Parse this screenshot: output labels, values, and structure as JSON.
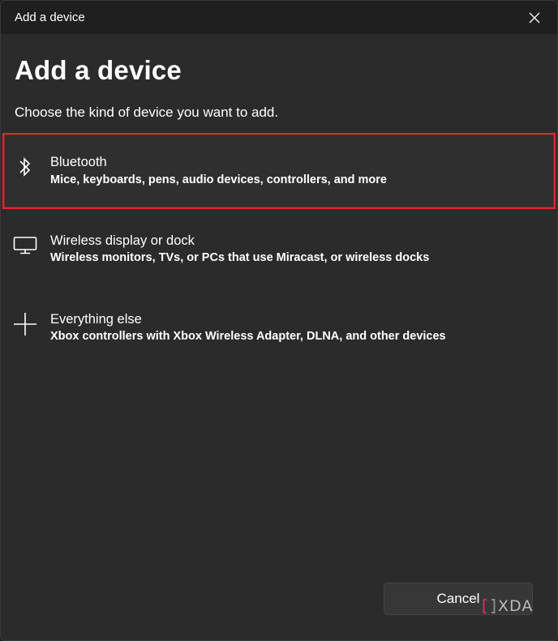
{
  "window": {
    "title": "Add a device"
  },
  "heading": "Add a device",
  "subtitle": "Choose the kind of device you want to add.",
  "options": [
    {
      "icon": "bluetooth-icon",
      "label": "Bluetooth",
      "description": "Mice, keyboards, pens, audio devices, controllers, and more",
      "selected": true
    },
    {
      "icon": "monitor-icon",
      "label": "Wireless display or dock",
      "description": "Wireless monitors, TVs, or PCs that use Miracast, or wireless docks",
      "selected": false
    },
    {
      "icon": "plus-icon",
      "label": "Everything else",
      "description": "Xbox controllers with Xbox Wireless Adapter, DLNA, and other devices",
      "selected": false
    }
  ],
  "cancel_label": "Cancel",
  "watermark": {
    "text": "XDA"
  },
  "colors": {
    "selection_border": "#e3262c",
    "background": "#2b2b2b",
    "titlebar": "#1f1f1f"
  }
}
